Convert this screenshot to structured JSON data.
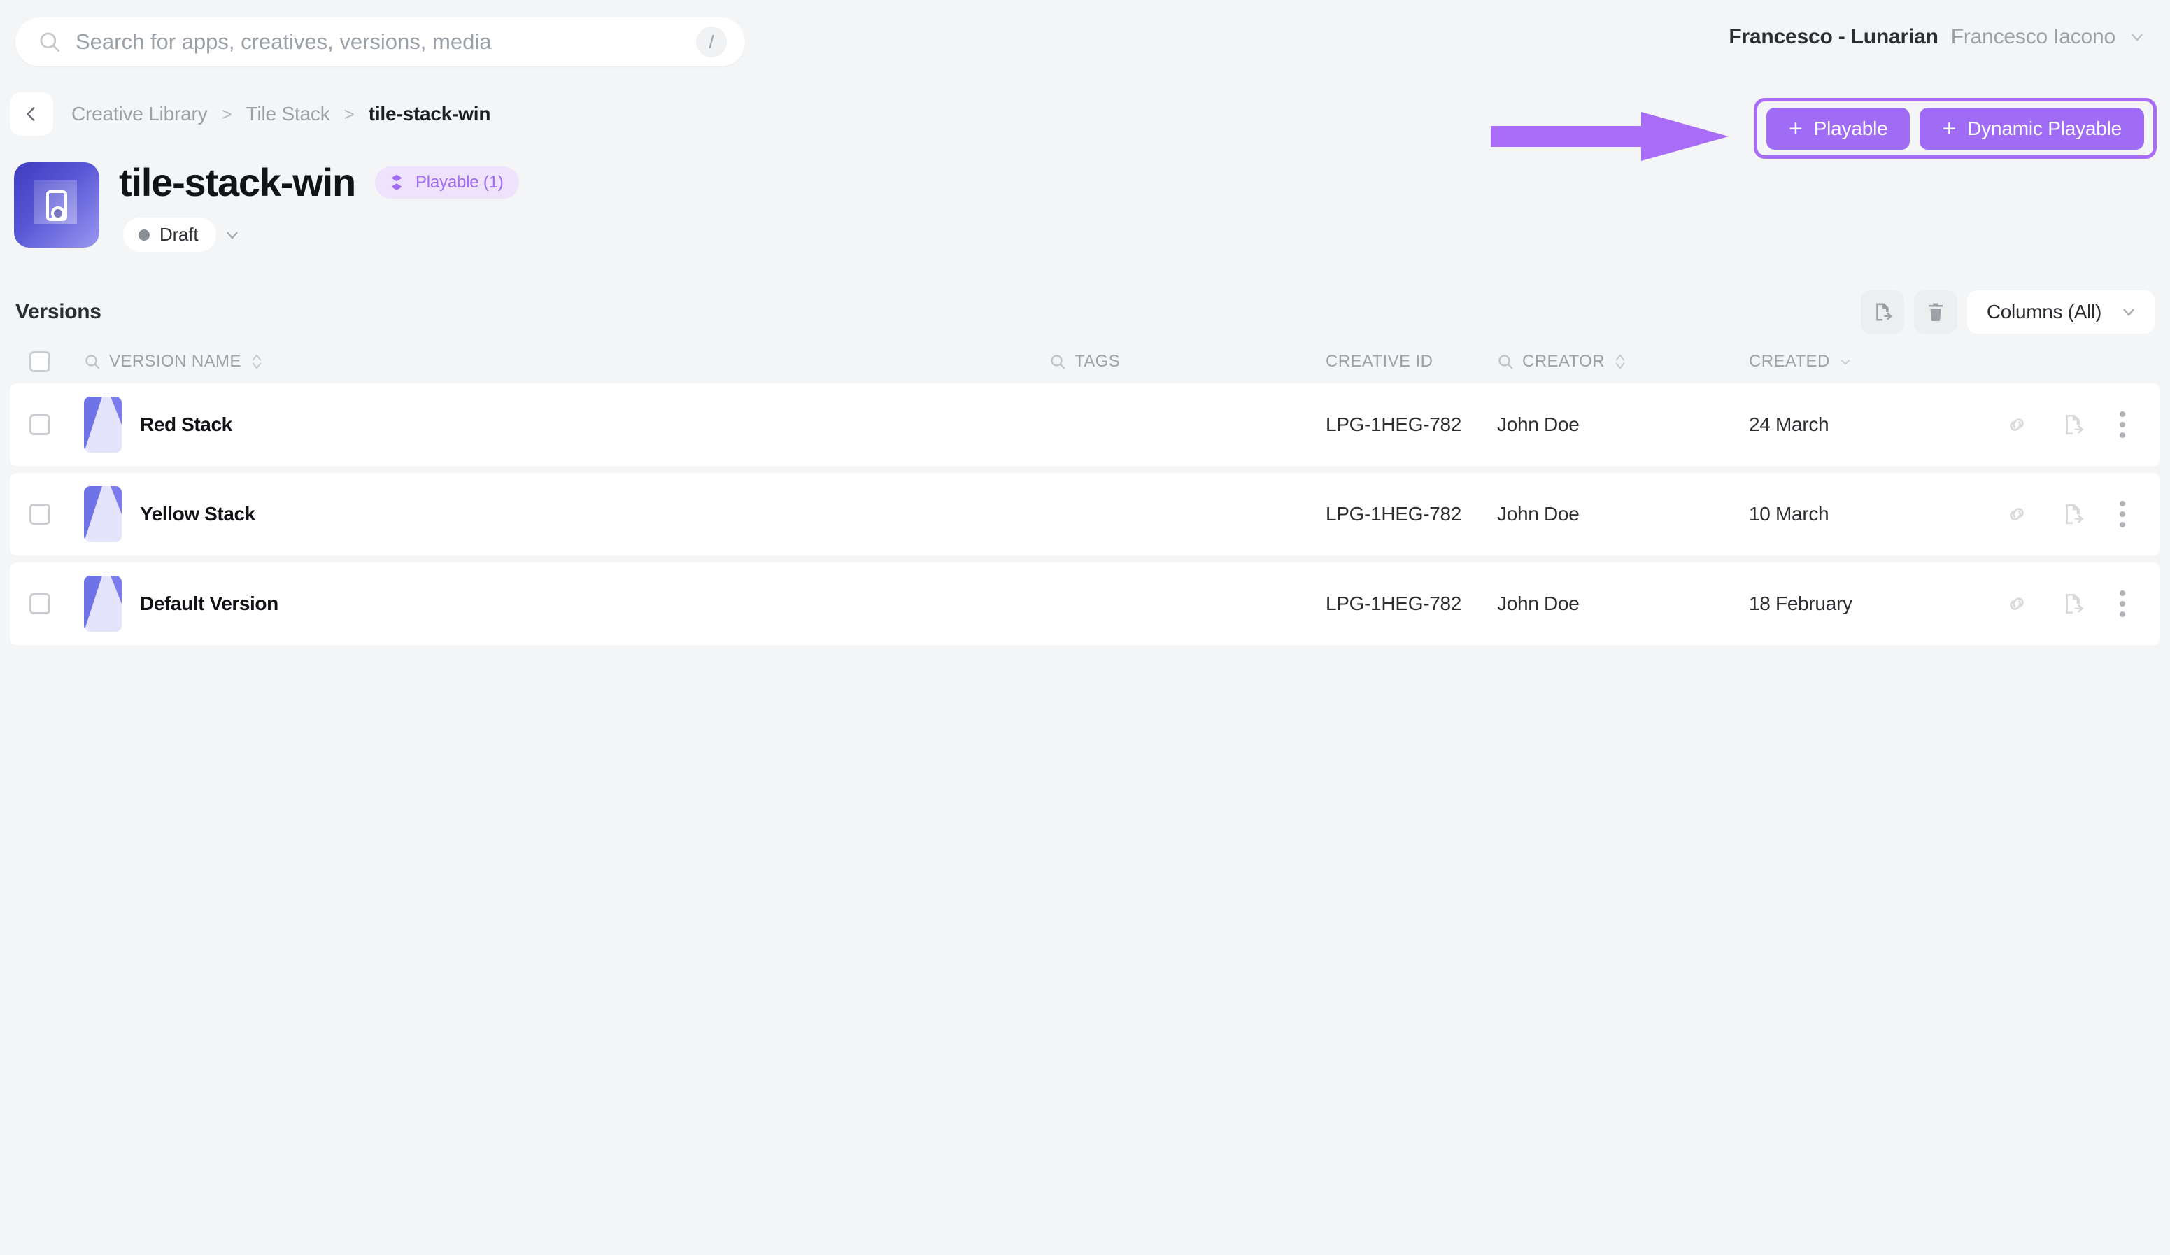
{
  "search": {
    "placeholder": "Search for apps, creatives, versions, media",
    "value": "",
    "shortcut": "/",
    "icon": "search-icon"
  },
  "account": {
    "org": "Francesco - Lunarian",
    "user": "Francesco Iacono",
    "chevron_icon": "chevron-down-icon"
  },
  "breadcrumb": {
    "back_icon": "chevron-left-icon",
    "items": [
      {
        "label": "Creative Library",
        "current": false
      },
      {
        "label": "Tile Stack",
        "current": false
      },
      {
        "label": "tile-stack-win",
        "current": true
      }
    ],
    "separator": ">"
  },
  "header": {
    "app_icon": "mobile-app-icon",
    "title": "tile-stack-win",
    "badge": {
      "label": "Playable (1)",
      "icon": "stacked-diamond-icon"
    },
    "status": {
      "label": "Draft",
      "dot_color": "#8A9096",
      "chevron_icon": "chevron-down-icon"
    }
  },
  "actions": {
    "playable_label": "Playable",
    "dynamic_playable_label": "Dynamic Playable",
    "plus": "+",
    "highlight_color": "#A86CF7",
    "button_color": "#A06BF5",
    "annotation": "arrow-pointing-right"
  },
  "versions": {
    "title": "Versions",
    "tools": {
      "export_icon": "file-export-icon",
      "delete_icon": "trash-icon",
      "columns_label": "Columns (All)",
      "columns_chevron_icon": "chevron-down-icon"
    },
    "columns": [
      {
        "key": "name",
        "label": "VERSION NAME",
        "searchable": true,
        "sortable": true
      },
      {
        "key": "tags",
        "label": "TAGS",
        "searchable": true,
        "sortable": false
      },
      {
        "key": "cid",
        "label": "CREATIVE ID",
        "searchable": false,
        "sortable": false
      },
      {
        "key": "creator",
        "label": "CREATOR",
        "searchable": true,
        "sortable": true
      },
      {
        "key": "created",
        "label": "CREATED",
        "searchable": false,
        "sortable": false,
        "sorted_desc": true
      }
    ],
    "rows": [
      {
        "name": "Red Stack",
        "tags": "",
        "cid": "LPG-1HEG-782",
        "creator": "John Doe",
        "created": "24 March"
      },
      {
        "name": "Yellow Stack",
        "tags": "",
        "cid": "LPG-1HEG-782",
        "creator": "John Doe",
        "created": "10 March"
      },
      {
        "name": "Default Version",
        "tags": "",
        "cid": "LPG-1HEG-782",
        "creator": "John Doe",
        "created": "18 February"
      }
    ],
    "row_actions": {
      "link_icon": "link-icon",
      "export_icon": "file-export-icon",
      "more_icon": "kebab-menu-icon"
    }
  }
}
